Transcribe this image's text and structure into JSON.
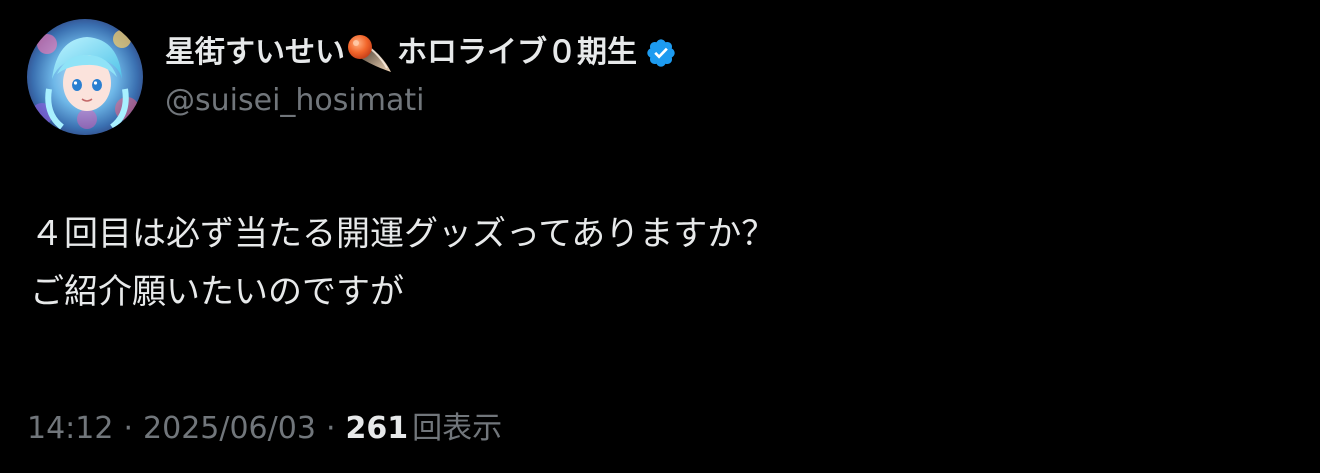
{
  "author": {
    "display_name": "星街すいせい",
    "name_suffix": "ホロライブ０期生",
    "name_emoji": "comet-icon",
    "handle": "@suisei_hosimati",
    "verified": true,
    "verified_color": "#1d9bf0",
    "avatar": "avatar-image"
  },
  "tweet": {
    "text": "４回目は必ず当たる開運グッズってありますか？\nご紹介願いたいのですが"
  },
  "meta": {
    "time": "14:12",
    "separator": "·",
    "date": "2025/06/03",
    "views_count": "261",
    "views_label": "回表示"
  },
  "colors": {
    "background": "#000000",
    "primary_text": "#e7e9ea",
    "secondary_text": "#71767b",
    "verified": "#1d9bf0"
  }
}
